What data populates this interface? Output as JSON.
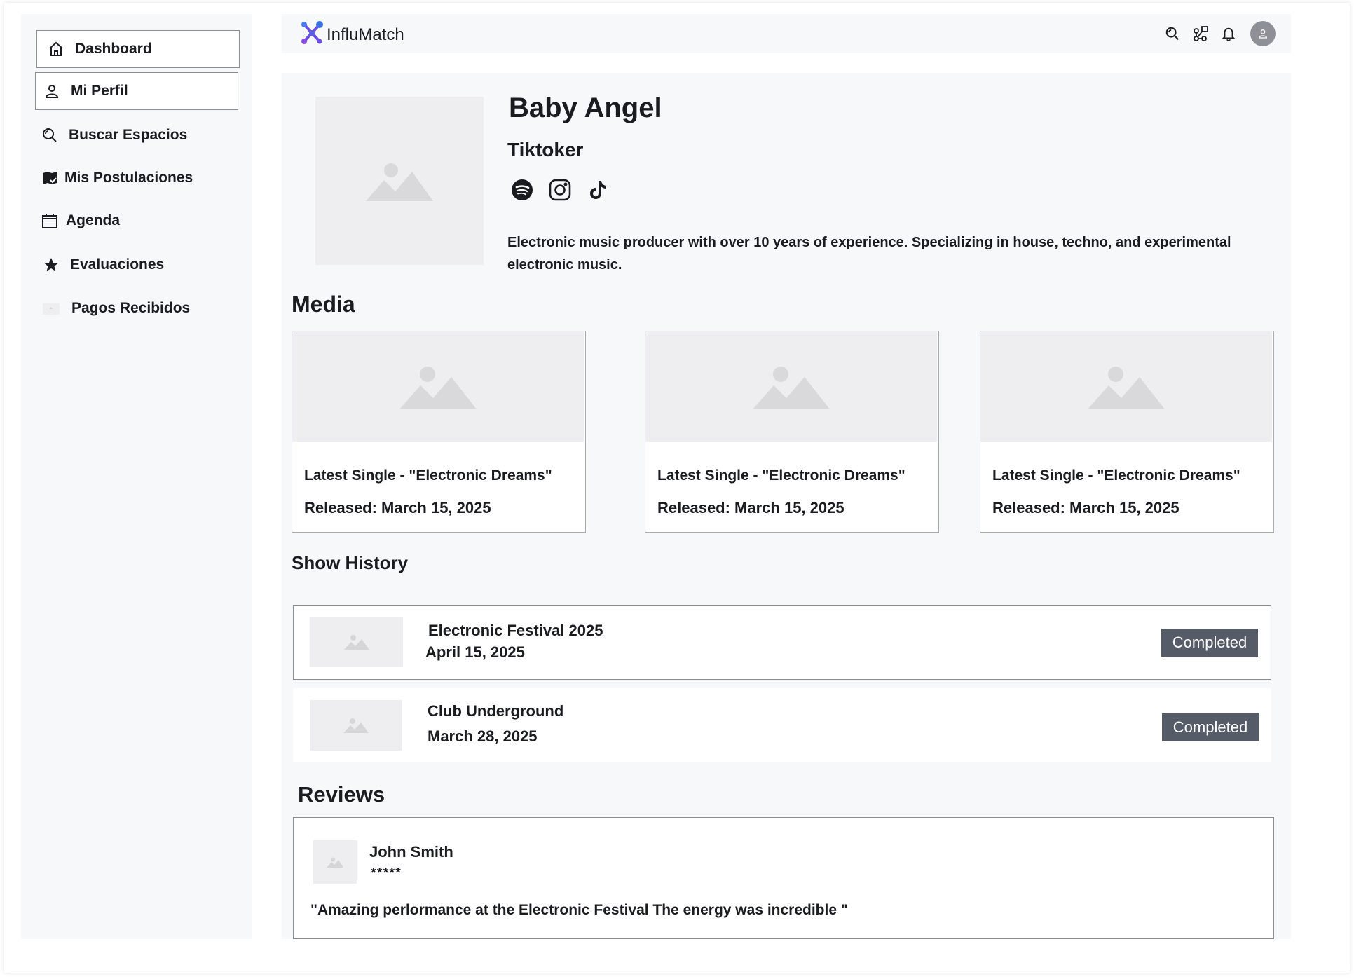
{
  "brand": {
    "name": "InfluMatch",
    "accent": "#6b4de6"
  },
  "sidebar": {
    "items": [
      {
        "label": "Dashboard",
        "icon": "home-icon"
      },
      {
        "label": "Mi Perfil",
        "icon": "user-icon"
      },
      {
        "label": "Buscar Espacios",
        "icon": "search-icon"
      },
      {
        "label": "Mis Postulaciones",
        "icon": "applications-icon"
      },
      {
        "label": "Agenda",
        "icon": "calendar-icon"
      },
      {
        "label": "Evaluaciones",
        "icon": "star-icon"
      },
      {
        "label": "Pagos Recibidos",
        "icon": "payments-icon"
      }
    ]
  },
  "topbar": {
    "icons": [
      "search-icon",
      "network-icon",
      "bell-icon",
      "avatar"
    ]
  },
  "profile": {
    "name": "Baby Angel",
    "role": "Tiktoker",
    "socials": [
      "spotify-icon",
      "instagram-icon",
      "tiktok-icon"
    ],
    "bio": "Electronic music producer with over 10 years of experience. Specializing in house, techno, and experimental electronic music."
  },
  "media": {
    "title": "Media",
    "items": [
      {
        "title": "Latest Single - \"Electronic Dreams\"",
        "date": "Released: March 15, 2025"
      },
      {
        "title": "Latest Single - \"Electronic Dreams\"",
        "date": "Released: March 15, 2025"
      },
      {
        "title": "Latest Single - \"Electronic Dreams\"",
        "date": "Released: March 15, 2025"
      }
    ]
  },
  "show_history": {
    "title": "Show History",
    "items": [
      {
        "name": "Electronic Festival 2025",
        "date": "April 15, 2025",
        "status": "Completed"
      },
      {
        "name": "Club Underground",
        "date": "March 28, 2025",
        "status": "Completed"
      }
    ]
  },
  "reviews": {
    "title": "Reviews",
    "items": [
      {
        "author": "John Smith",
        "stars": "*****",
        "text": "\"Amazing perlormance at the Electronic Festival  The energy was incredible \""
      }
    ]
  },
  "colors": {
    "panel": "#f7f8fa",
    "badge": "#565b68",
    "placeholder": "#eeeef0"
  }
}
